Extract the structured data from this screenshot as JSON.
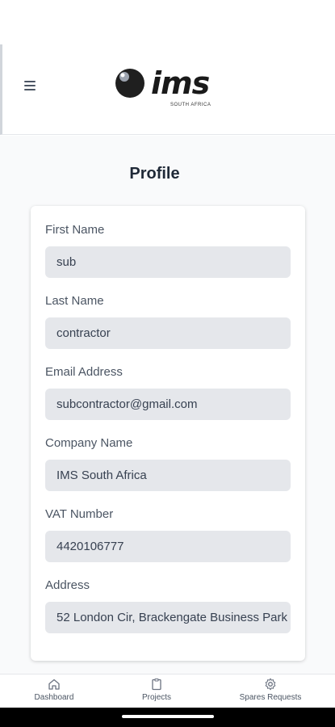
{
  "header": {
    "menu_icon": "hamburger-icon",
    "logo_text": "ims",
    "logo_subtext": "SOUTH AFRICA"
  },
  "page": {
    "title": "Profile"
  },
  "form": {
    "fields": [
      {
        "label": "First Name",
        "value": "sub"
      },
      {
        "label": "Last Name",
        "value": "contractor"
      },
      {
        "label": "Email Address",
        "value": "subcontractor@gmail.com"
      },
      {
        "label": "Company Name",
        "value": "IMS South Africa"
      },
      {
        "label": "VAT Number",
        "value": "4420106777"
      },
      {
        "label": "Address",
        "value": "52 London Cir, Brackengate Business Park"
      }
    ]
  },
  "bottom_nav": {
    "items": [
      {
        "label": "Dashboard",
        "icon": "home-icon"
      },
      {
        "label": "Projects",
        "icon": "clipboard-icon"
      },
      {
        "label": "Spares Requests",
        "icon": "gear-icon"
      }
    ]
  },
  "colors": {
    "input_bg": "#e5e7eb",
    "text_dark": "#1f2937",
    "label": "#4b5563"
  }
}
